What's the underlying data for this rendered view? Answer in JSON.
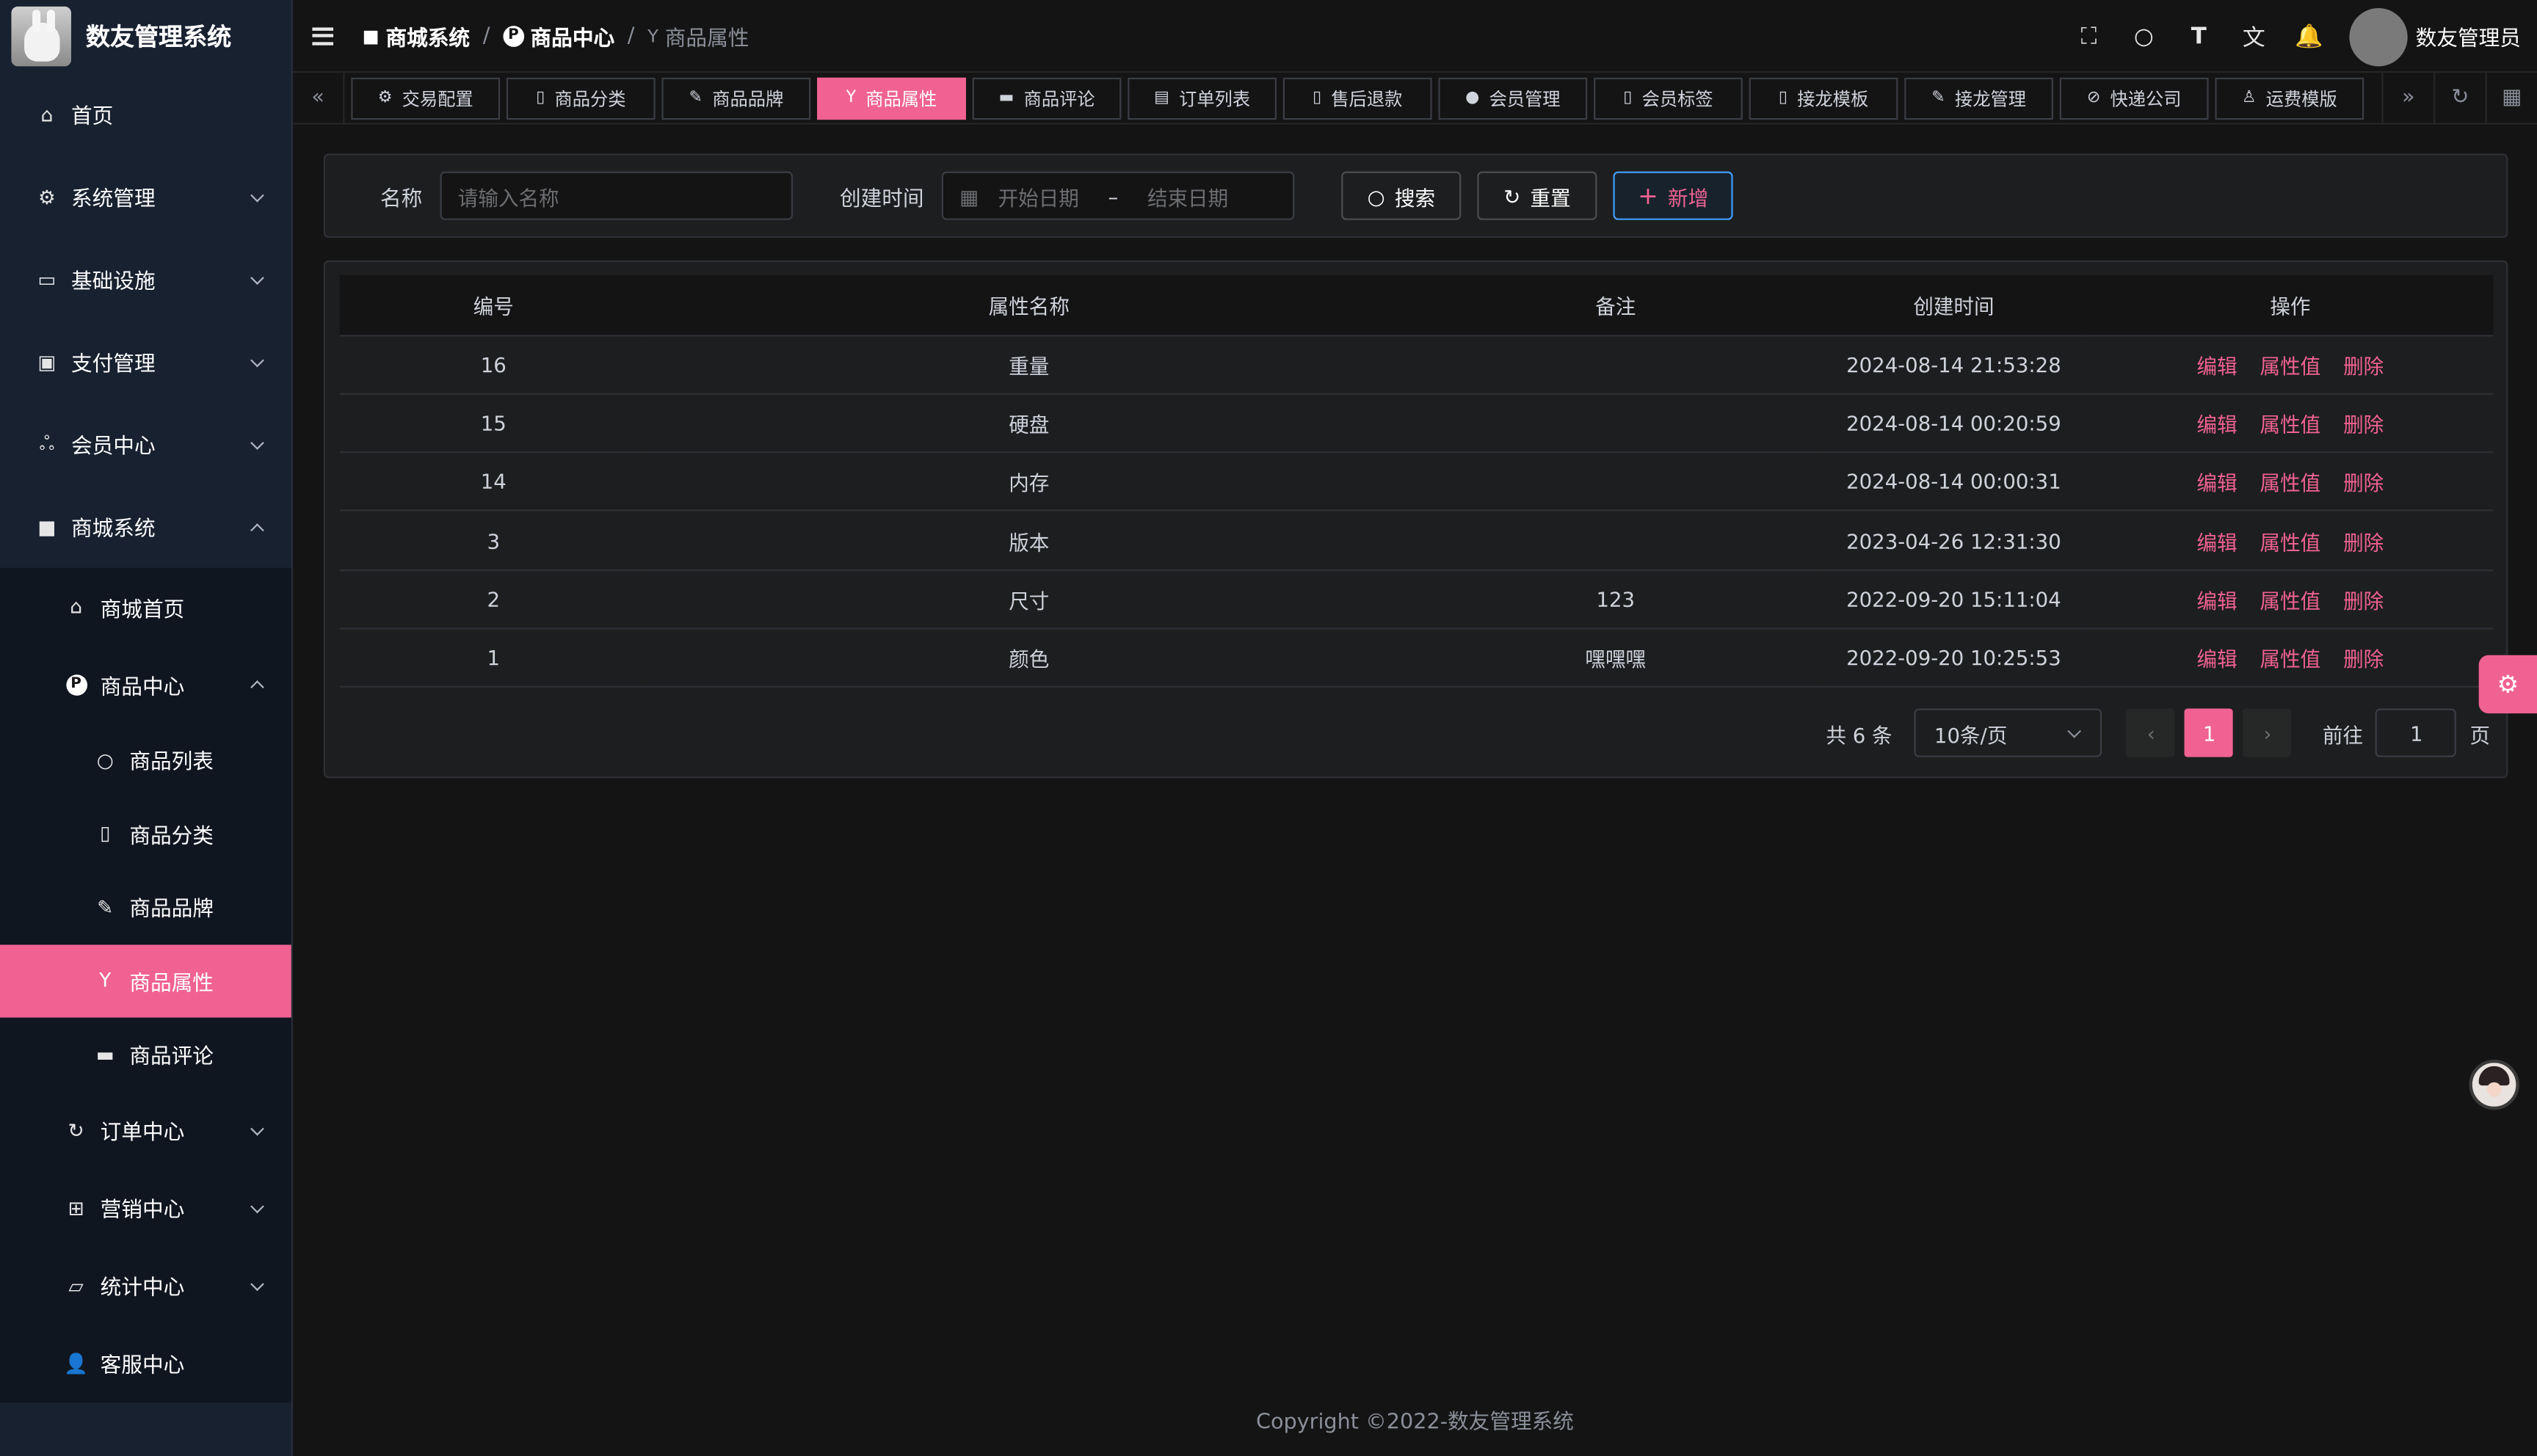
{
  "app": {
    "title": "数友管理系统"
  },
  "sidebar": {
    "items": [
      {
        "label": "首页",
        "icon": "home-icon"
      },
      {
        "label": "系统管理",
        "icon": "gear-icon"
      },
      {
        "label": "基础设施",
        "icon": "monitor-icon"
      },
      {
        "label": "支付管理",
        "icon": "wallet-icon"
      },
      {
        "label": "会员中心",
        "icon": "members-icon"
      },
      {
        "label": "商城系统",
        "icon": "shop-icon"
      }
    ],
    "mall": [
      {
        "label": "商城首页",
        "icon": "home-icon"
      },
      {
        "label": "商品中心",
        "icon": "p-circle-icon"
      }
    ],
    "product": [
      {
        "label": "商品列表",
        "icon": "apple-icon"
      },
      {
        "label": "商品分类",
        "icon": "category-icon"
      },
      {
        "label": "商品品牌",
        "icon": "brand-icon"
      },
      {
        "label": "商品属性",
        "icon": "attribute-icon"
      },
      {
        "label": "商品评论",
        "icon": "comment-icon"
      }
    ],
    "mall_rest": [
      {
        "label": "订单中心",
        "icon": "order-icon"
      },
      {
        "label": "营销中心",
        "icon": "gift-icon"
      },
      {
        "label": "统计中心",
        "icon": "chart-icon"
      },
      {
        "label": "客服中心",
        "icon": "user-icon"
      }
    ]
  },
  "breadcrumb": [
    "商城系统",
    "商品中心",
    "商品属性"
  ],
  "header": {
    "username": "数友管理员",
    "p_letter": "P"
  },
  "tags": [
    "交易配置",
    "商品分类",
    "商品品牌",
    "商品属性",
    "商品评论",
    "订单列表",
    "售后退款",
    "会员管理",
    "会员标签",
    "接龙模板",
    "接龙管理",
    "快递公司",
    "运费模版"
  ],
  "search": {
    "name_label": "名称",
    "name_placeholder": "请输入名称",
    "time_label": "创建时间",
    "start_placeholder": "开始日期",
    "range_sep": "–",
    "end_placeholder": "结束日期",
    "search_btn": "搜索",
    "reset_btn": "重置",
    "add_btn": "新增"
  },
  "table": {
    "columns": [
      "编号",
      "属性名称",
      "备注",
      "创建时间",
      "操作"
    ],
    "actions": [
      "编辑",
      "属性值",
      "删除"
    ],
    "rows": [
      [
        "16",
        "重量",
        "",
        "2024-08-14 21:53:28"
      ],
      [
        "15",
        "硬盘",
        "",
        "2024-08-14 00:20:59"
      ],
      [
        "14",
        "内存",
        "",
        "2024-08-14 00:00:31"
      ],
      [
        "3",
        "版本",
        "",
        "2023-04-26 12:31:30"
      ],
      [
        "2",
        "尺寸",
        "123",
        "2022-09-20 15:11:04"
      ],
      [
        "1",
        "颜色",
        "嘿嘿嘿",
        "2022-09-20 10:25:53"
      ]
    ]
  },
  "pagination": {
    "total": "共 6 条",
    "page_size": "10条/页",
    "current": "1",
    "goto_label": "前往",
    "goto_value": "1",
    "page_suffix": "页"
  },
  "footer": {
    "copyright": "Copyright ©2022-数友管理系统"
  },
  "colors": {
    "accent": "#f06292",
    "sidebar_bg": "#182130",
    "page_bg": "#141414",
    "panel_bg": "#1d1e1f"
  }
}
